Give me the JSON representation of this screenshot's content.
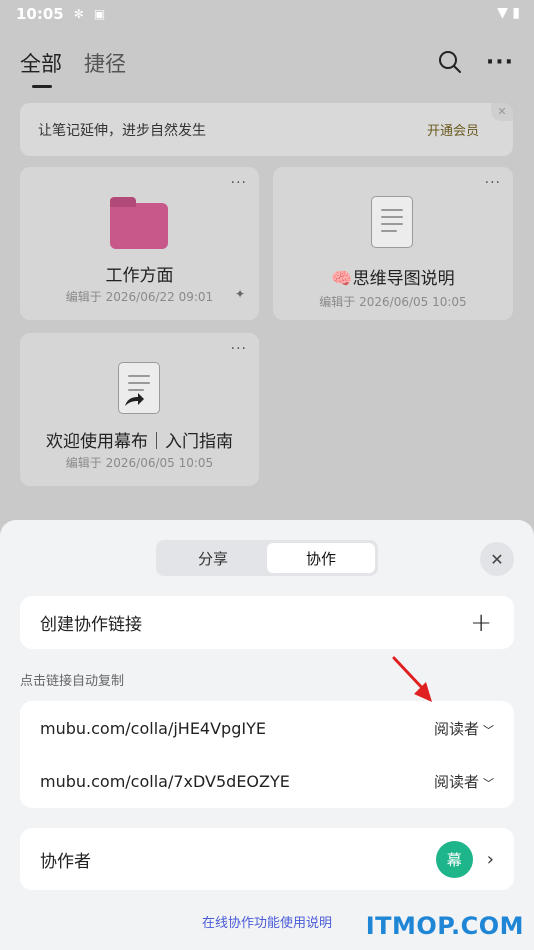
{
  "status_bar": {
    "time": "10:05"
  },
  "header": {
    "tabs": [
      {
        "label": "全部"
      },
      {
        "label": "捷径"
      }
    ]
  },
  "promo": {
    "text": "让笔记延伸，进步自然发生",
    "action": "开通会员"
  },
  "cards": [
    {
      "title": "工作方面",
      "meta": "编辑于 2026/06/22 09:01"
    },
    {
      "title": "🧠思维导图说明",
      "meta": "编辑于 2026/06/05 10:05"
    },
    {
      "title": "欢迎使用幕布｜入门指南",
      "meta": "编辑于 2026/06/05 10:05"
    }
  ],
  "sheet": {
    "tabs": [
      {
        "label": "分享"
      },
      {
        "label": "协作"
      }
    ],
    "create_link_label": "创建协作链接",
    "hint": "点击链接自动复制",
    "links": [
      {
        "url": "mubu.com/colla/jHE4VpgIYE",
        "role": "阅读者"
      },
      {
        "url": "mubu.com/colla/7xDV5dEOZYE",
        "role": "阅读者"
      }
    ],
    "collaborators_label": "协作者",
    "avatar_text": "幕",
    "help_link": "在线协作功能使用说明"
  },
  "watermark": "ITMOP.COM",
  "colors": {
    "accent_green": "#1eb58a",
    "link_blue": "#4a5bd8",
    "arrow_red": "#e02020",
    "folder_pink": "#c8588a"
  }
}
